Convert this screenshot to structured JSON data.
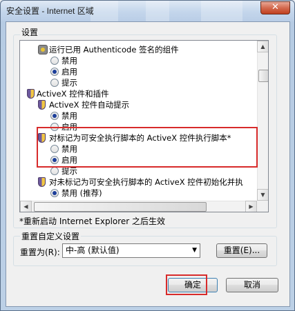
{
  "window": {
    "title": "安全设置 - Internet 区域",
    "close_glyph": "✕"
  },
  "settings": {
    "group_label": "设置",
    "items": [
      {
        "type": "setting",
        "icon": "gear-icon",
        "label": "运行已用 Authenticode 签名的组件"
      },
      {
        "type": "option",
        "label": "禁用",
        "selected": false
      },
      {
        "type": "option",
        "label": "启用",
        "selected": true
      },
      {
        "type": "option",
        "label": "提示",
        "selected": false
      },
      {
        "type": "category",
        "icon": "shield-icon",
        "label": "ActiveX 控件和插件"
      },
      {
        "type": "setting",
        "icon": "shield-icon",
        "label": "ActiveX 控件自动提示"
      },
      {
        "type": "option",
        "label": "禁用",
        "selected": true
      },
      {
        "type": "option",
        "label": "启用",
        "selected": false
      },
      {
        "type": "setting",
        "icon": "shield-icon",
        "label": "对标记为可安全执行脚本的 ActiveX 控件执行脚本*"
      },
      {
        "type": "option",
        "label": "禁用",
        "selected": false
      },
      {
        "type": "option",
        "label": "启用",
        "selected": true
      },
      {
        "type": "option",
        "label": "提示",
        "selected": false
      },
      {
        "type": "setting",
        "icon": "shield-icon",
        "label": "对未标记为可安全执行脚本的 ActiveX 控件初始化并执"
      },
      {
        "type": "option",
        "label": "禁用 (推荐)",
        "selected": true
      }
    ],
    "restart_note": "*重新启动 Internet Explorer 之后生效"
  },
  "reset": {
    "group_label": "重置自定义设置",
    "reset_to_label": "重置为(R):",
    "level_value": "中-高 (默认值)",
    "reset_button": "重置(E)..."
  },
  "footer": {
    "ok_button": "确定",
    "cancel_button": "取消"
  },
  "annotation_color": "#d72a2a"
}
